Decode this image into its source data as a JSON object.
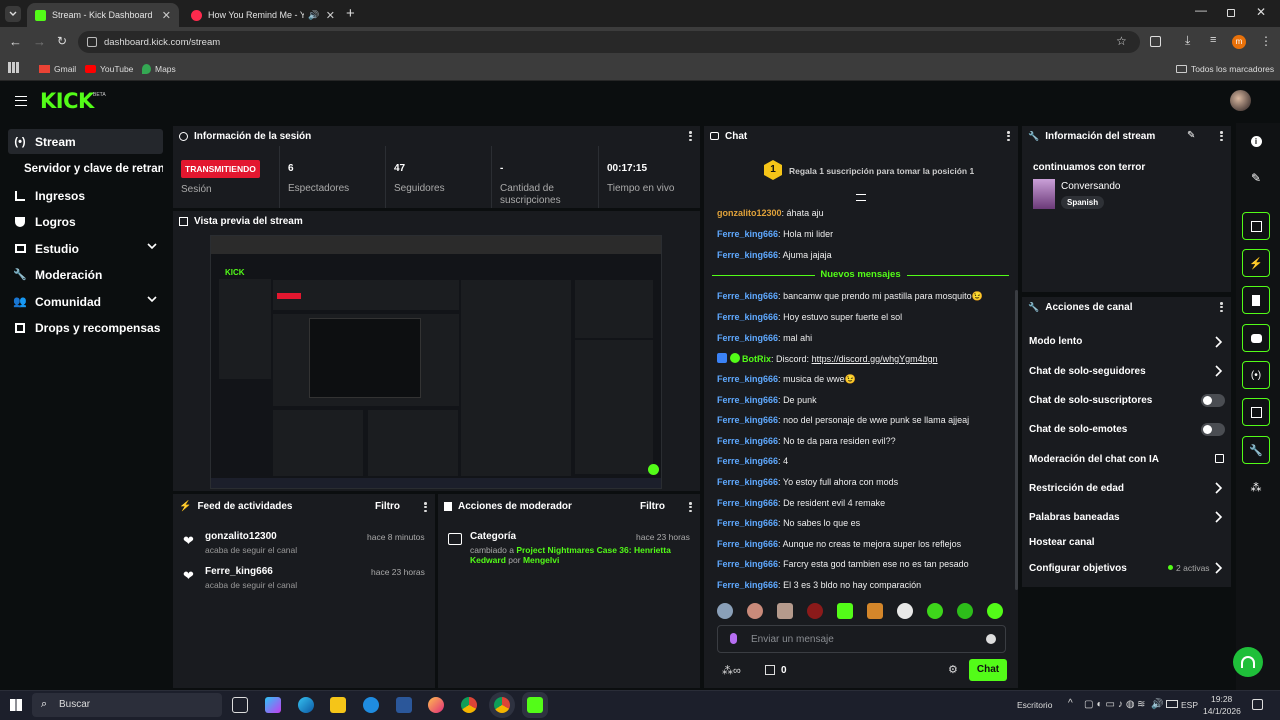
{
  "browser": {
    "tabs": [
      {
        "title": "Stream - Kick Dashboard"
      },
      {
        "title": "How You Remind Me - You"
      }
    ],
    "url": "dashboard.kick.com/stream",
    "bookmarks": [
      "Gmail",
      "YouTube",
      "Maps"
    ],
    "all_bookmarks": "Todos los marcadores",
    "profile_initial": "m"
  },
  "kick": {
    "logo": "KICK",
    "logo_badge": "BETA"
  },
  "sidebar": {
    "items": [
      {
        "label": "Stream"
      },
      {
        "label": "Servidor y clave de retransmisión"
      },
      {
        "label": "Ingresos"
      },
      {
        "label": "Logros"
      },
      {
        "label": "Estudio"
      },
      {
        "label": "Moderación"
      },
      {
        "label": "Comunidad"
      },
      {
        "label": "Drops y recompensas"
      }
    ]
  },
  "session": {
    "title": "Información de la sesión",
    "live_badge": "TRANSMITIENDO",
    "live_label": "Sesión",
    "stats": [
      {
        "value": "6",
        "label": "Espectadores"
      },
      {
        "value": "47",
        "label": "Seguidores"
      },
      {
        "value": "-",
        "label": "Cantidad de suscripciones"
      },
      {
        "value": "00:17:15",
        "label": "Tiempo en vivo"
      }
    ]
  },
  "preview": {
    "title": "Vista previa del stream"
  },
  "feed": {
    "title": "Feed de actividades",
    "filter": "Filtro",
    "items": [
      {
        "user": "gonzalito12300",
        "action": "acaba de seguir el canal",
        "time": "hace 8 minutos"
      },
      {
        "user": "Ferre_king666",
        "action": "acaba de seguir el canal",
        "time": "hace 23 horas"
      }
    ]
  },
  "modactions": {
    "title": "Acciones de moderador",
    "filter": "Filtro",
    "item": {
      "category_label": "Categoría",
      "time": "hace 23 horas",
      "prefix": "cambiado a",
      "game": "Project Nightmares Case 36: Henrietta Kedward",
      "by": "por",
      "moderator": "Mengelvi"
    }
  },
  "chat": {
    "title": "Chat",
    "sub_rank": "1",
    "sub_prompt": "Regala 1 suscripción para tomar la posición 1",
    "new_messages": "Nuevos mensajes",
    "messages_before": [
      {
        "user": "gonzalito12300",
        "sep": ": ",
        "text": "áhata aju",
        "color": "orange"
      },
      {
        "user": "Ferre_king666",
        "sep": ": ",
        "text": "Hola mi lider",
        "color": "blue"
      },
      {
        "user": "Ferre_king666",
        "sep": ": ",
        "text": "Ajuma jajaja",
        "color": "blue"
      }
    ],
    "messages_after": [
      {
        "user": "Ferre_king666",
        "sep": ": ",
        "text": "bancamw que prendo mi pastilla para mosquito😉"
      },
      {
        "user": "Ferre_king666",
        "sep": ": ",
        "text": "Hoy estuvo super fuerte el sol"
      },
      {
        "user": "Ferre_king666",
        "sep": ": ",
        "text": "mal ahi"
      },
      {
        "user": "BotRix",
        "sep": ": ",
        "text": "Discord: ",
        "link": "https://discord.gg/whgYgm4bgn",
        "color": "green"
      },
      {
        "user": "Ferre_king666",
        "sep": ": ",
        "text": "musica de wwe😉"
      },
      {
        "user": "Ferre_king666",
        "sep": ": ",
        "text": "De punk"
      },
      {
        "user": "Ferre_king666",
        "sep": ": ",
        "text": "noo del personaje de wwe punk se llama ajjeaj"
      },
      {
        "user": "Ferre_king666",
        "sep": ": ",
        "text": "No te da para residen evil??"
      },
      {
        "user": "Ferre_king666",
        "sep": ": ",
        "text": "4"
      },
      {
        "user": "Ferre_king666",
        "sep": ": ",
        "text": "Yo estoy full ahora con mods"
      },
      {
        "user": "Ferre_king666",
        "sep": ": ",
        "text": "De resident evil 4 remake"
      },
      {
        "user": "Ferre_king666",
        "sep": ": ",
        "text": "No sabes lo que es"
      },
      {
        "user": "Ferre_king666",
        "sep": ": ",
        "text": "Aunque no creas te mejora super los reflejos"
      },
      {
        "user": "Ferre_king666",
        "sep": ": ",
        "text": "Farcry esta god tambien ese no es tan pesado"
      },
      {
        "user": "Ferre_king666",
        "sep": ": ",
        "text": "El 3 es 3 bldo no hay comparación"
      }
    ],
    "input_placeholder": "Enviar un mensaje",
    "points_value": "0",
    "send_label": "Chat"
  },
  "streaminfo": {
    "title": "Información del stream",
    "stream_title": "continuamos con terror",
    "category": "Conversando",
    "language": "Spanish"
  },
  "channel": {
    "title": "Acciones de canal",
    "settings": [
      {
        "label": "Modo lento"
      },
      {
        "label": "Chat de solo-seguidores"
      },
      {
        "label": "Chat de solo-suscriptores"
      },
      {
        "label": "Chat de solo-emotes"
      },
      {
        "label": "Moderación del chat con IA"
      },
      {
        "label": "Restricción de edad"
      },
      {
        "label": "Palabras baneadas"
      },
      {
        "label": "Hostear canal"
      },
      {
        "label": "Configurar objetivos"
      }
    ],
    "goals_active": "2 activas"
  },
  "taskbar": {
    "search": "Buscar",
    "desktop": "Escritorio",
    "lang": "ESP",
    "time": "19:28",
    "date": "14/1/2026"
  },
  "colors": {
    "accent": "#53fc18",
    "live": "#e3172f",
    "panel": "#191b1f",
    "bg": "#0b0e0f"
  }
}
